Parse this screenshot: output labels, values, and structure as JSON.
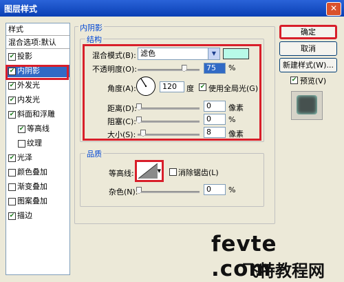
{
  "window": {
    "title": "图层样式"
  },
  "sidebar": {
    "items": [
      {
        "label": "样式",
        "checkbox": false,
        "checked": false
      },
      {
        "label": "混合选项:默认",
        "checkbox": false,
        "checked": false
      },
      {
        "label": "投影",
        "checkbox": true,
        "checked": true
      },
      {
        "label": "内阴影",
        "checkbox": true,
        "checked": true,
        "selected": true
      },
      {
        "label": "外发光",
        "checkbox": true,
        "checked": true
      },
      {
        "label": "内发光",
        "checkbox": true,
        "checked": true
      },
      {
        "label": "斜面和浮雕",
        "checkbox": true,
        "checked": true
      },
      {
        "label": "等高线",
        "checkbox": true,
        "checked": true
      },
      {
        "label": "纹理",
        "checkbox": true,
        "checked": false
      },
      {
        "label": "光泽",
        "checkbox": true,
        "checked": true
      },
      {
        "label": "颜色叠加",
        "checkbox": true,
        "checked": false
      },
      {
        "label": "渐变叠加",
        "checkbox": true,
        "checked": false
      },
      {
        "label": "图案叠加",
        "checkbox": true,
        "checked": false
      },
      {
        "label": "描边",
        "checkbox": true,
        "checked": true
      }
    ]
  },
  "inner_shadow": {
    "group_title": "内阴影",
    "structure": {
      "title": "结构",
      "blend_mode_label": "混合模式(B):",
      "blend_mode_value": "滤色",
      "swatch_color": "#b8fae8",
      "opacity_label": "不透明度(O):",
      "opacity_value": "75",
      "opacity_unit": "%",
      "opacity_level": 0.75,
      "angle_label": "角度(A):",
      "angle_value": "120",
      "angle_unit": "度",
      "global_light_label": "使用全局光(G)",
      "global_light_checked": true,
      "distance_label": "距离(D):",
      "distance_value": "0",
      "distance_unit": "像素",
      "choke_label": "阻塞(C):",
      "choke_value": "0",
      "choke_unit": "%",
      "size_label": "大小(S):",
      "size_value": "8",
      "size_unit": "像素"
    },
    "quality": {
      "title": "品质",
      "contour_label": "等高线:",
      "anti_alias_label": "消除锯齿(L)",
      "anti_alias_checked": false,
      "noise_label": "杂色(N):",
      "noise_value": "0",
      "noise_unit": "%"
    }
  },
  "buttons": {
    "ok": "确定",
    "cancel": "取消",
    "new_style": "新建样式(W)...",
    "preview_label": "预览(V)",
    "preview_checked": true
  },
  "watermark": {
    "line1": "fevte .com",
    "line2": "飞特教程网"
  },
  "colors": {
    "highlight": "#d81e2a",
    "title_blue": "#0046d5",
    "selection": "#316ac5"
  }
}
